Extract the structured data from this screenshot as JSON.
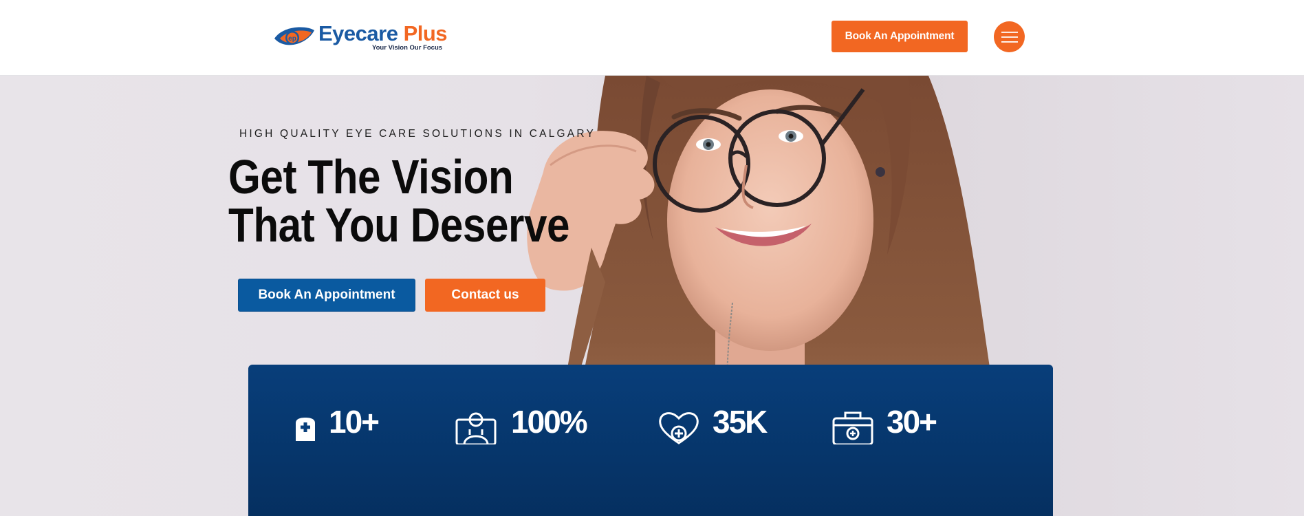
{
  "header": {
    "logo": {
      "name_part1": "Eyecare",
      "name_part2": "Plus",
      "tagline": "Your Vision Our Focus",
      "mark_text": "ep"
    },
    "book_button_label": "Book An Appointment",
    "menu_icon": "hamburger-menu-icon"
  },
  "hero": {
    "eyebrow": "HIGH QUALITY EYE CARE SOLUTIONS IN CALGARY",
    "headline_line1": "Get The Vision",
    "headline_line2": "That You Deserve",
    "primary_button_label": "Book An Appointment",
    "secondary_button_label": "Contact us"
  },
  "stats": [
    {
      "icon": "medical-clipboard-icon",
      "value": "10+"
    },
    {
      "icon": "doctor-icon",
      "value": "100%"
    },
    {
      "icon": "heart-care-icon",
      "value": "35K"
    },
    {
      "icon": "medical-kit-icon",
      "value": "30+"
    }
  ],
  "colors": {
    "brand_blue": "#0a5aa0",
    "brand_orange": "#f26722",
    "stats_panel": "#083e7a",
    "hero_background": "#e6e1e7"
  }
}
